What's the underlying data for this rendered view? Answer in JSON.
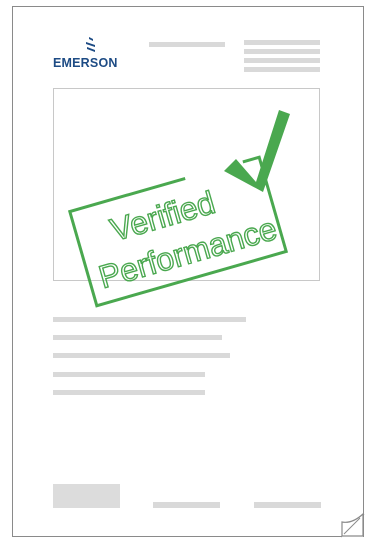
{
  "brand": {
    "name": "EMERSON",
    "color": "#1d4b84",
    "icon": "emerson-logo-icon"
  },
  "stamp": {
    "line1": "Verified",
    "line2": "Performance",
    "color": "#4aa84f",
    "icon": "checkmark-icon"
  },
  "placeholder_color": "#d9d9d9"
}
